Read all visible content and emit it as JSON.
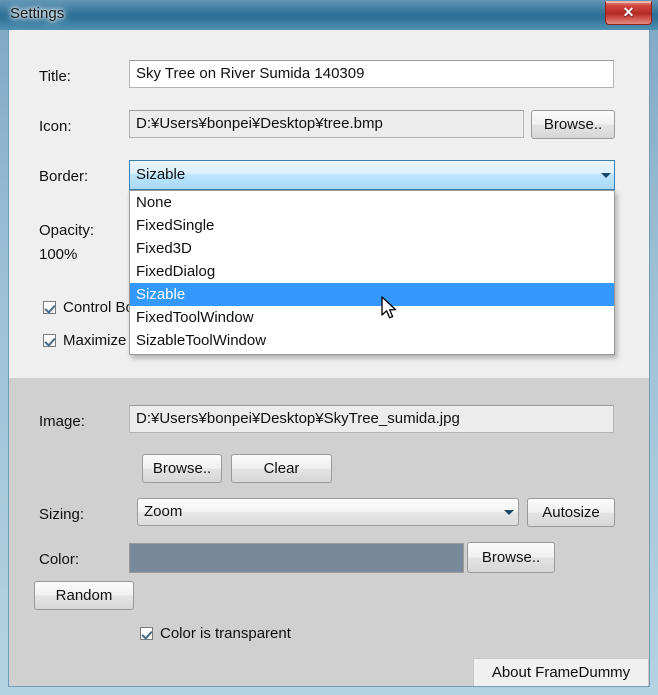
{
  "window": {
    "title": "Settings",
    "close_label": "✕",
    "titlebar_color": "#2c6e94",
    "panel_top_color": "#efefef",
    "panel_bottom_color": "#d0d0d0"
  },
  "form": {
    "title_label": "Title:",
    "title_value": "Sky Tree on River Sumida 140309",
    "icon_label": "Icon:",
    "icon_value": "D:¥Users¥bonpei¥Desktop¥tree.bmp",
    "icon_browse_label": "Browse..",
    "border_label": "Border:",
    "border_value": "Sizable",
    "border_options": [
      "None",
      "FixedSingle",
      "Fixed3D",
      "FixedDialog",
      "Sizable",
      "FixedToolWindow",
      "SizableToolWindow"
    ],
    "border_selected_index": 4,
    "opacity_label": "Opacity:",
    "opacity_value": "100%",
    "control_box_label": "Control Box",
    "control_box_checked": true,
    "maximize_label": "Maximize",
    "maximize_checked": true
  },
  "image_section": {
    "image_label": "Image:",
    "image_value": "D:¥Users¥bonpei¥Desktop¥SkyTree_sumida.jpg",
    "browse_label": "Browse..",
    "clear_label": "Clear",
    "sizing_label": "Sizing:",
    "sizing_value": "Zoom",
    "autosize_label": "Autosize",
    "color_label": "Color:",
    "color_value": "#78899b",
    "color_browse_label": "Browse..",
    "random_label": "Random",
    "transparent_label": "Color is transparent",
    "transparent_checked": true
  },
  "footer": {
    "about_label": "About FrameDummy"
  },
  "icons": {
    "dropdown_arrow": "chevron-down-icon",
    "close": "close-icon"
  }
}
